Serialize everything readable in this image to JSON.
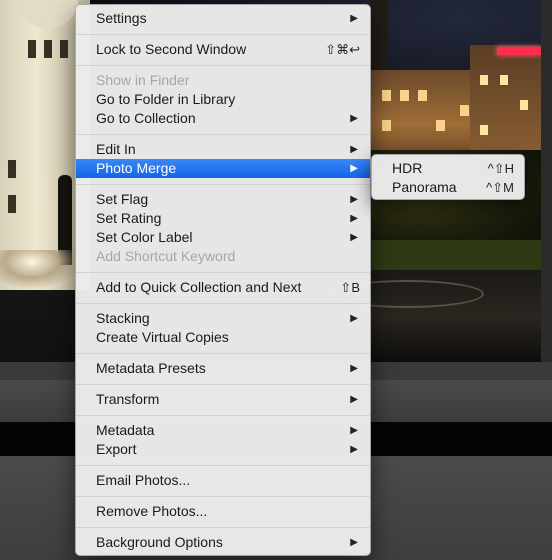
{
  "menu": {
    "items": [
      {
        "label": "Settings",
        "arrow": "▶"
      },
      {
        "label": "Lock to Second Window",
        "shortcut": "⇧⌘↩"
      },
      {
        "label": "Show in Finder"
      },
      {
        "label": "Go to Folder in Library"
      },
      {
        "label": "Go to Collection",
        "arrow": "▶"
      },
      {
        "label": "Edit In",
        "arrow": "▶"
      },
      {
        "label": "Photo Merge",
        "arrow": "▶"
      },
      {
        "label": "Set Flag",
        "arrow": "▶"
      },
      {
        "label": "Set Rating",
        "arrow": "▶"
      },
      {
        "label": "Set Color Label",
        "arrow": "▶"
      },
      {
        "label": "Add Shortcut Keyword"
      },
      {
        "label": "Add to Quick Collection and Next",
        "shortcut": "⇧B"
      },
      {
        "label": "Stacking",
        "arrow": "▶"
      },
      {
        "label": "Create Virtual Copies"
      },
      {
        "label": "Metadata Presets",
        "arrow": "▶"
      },
      {
        "label": "Transform",
        "arrow": "▶"
      },
      {
        "label": "Metadata",
        "arrow": "▶"
      },
      {
        "label": "Export",
        "arrow": "▶"
      },
      {
        "label": "Email Photos..."
      },
      {
        "label": "Remove Photos..."
      },
      {
        "label": "Background Options",
        "arrow": "▶"
      }
    ]
  },
  "submenu": {
    "items": [
      {
        "label": "HDR",
        "shortcut": "^⇧H"
      },
      {
        "label": "Panorama",
        "shortcut": "^⇧M"
      }
    ]
  },
  "colors": {
    "highlight": "#1a6cee",
    "menu_bg": "#ececec",
    "disabled_text": "#a6a6a6"
  }
}
